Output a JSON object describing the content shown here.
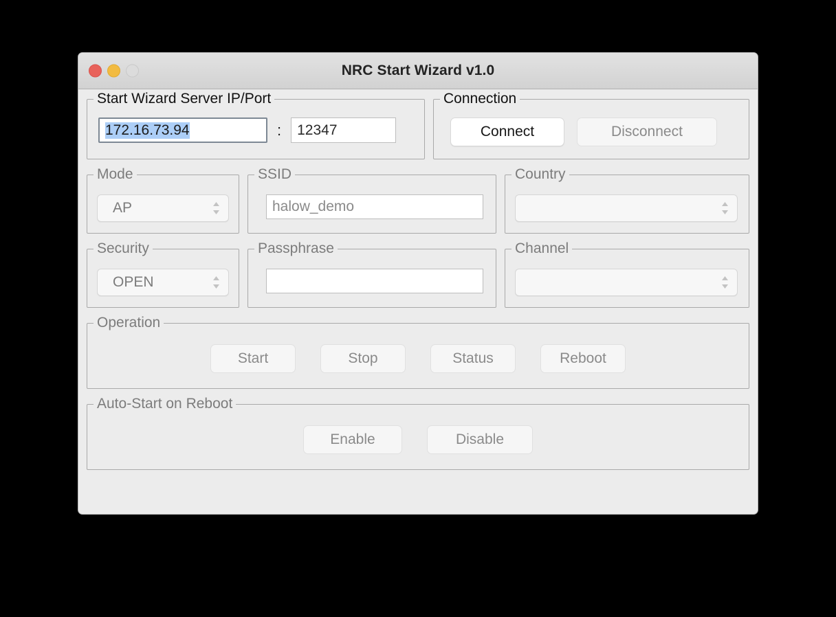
{
  "window": {
    "title": "NRC Start Wizard v1.0",
    "controls": {
      "close": "close-button",
      "minimize": "minimize-button",
      "zoom": "zoom-button"
    }
  },
  "server_group": {
    "legend": "Start Wizard Server IP/Port",
    "ip_value": "172.16.73.94",
    "separator": ":",
    "port_value": "12347"
  },
  "connection_group": {
    "legend": "Connection",
    "connect_label": "Connect",
    "disconnect_label": "Disconnect"
  },
  "mode_group": {
    "legend": "Mode",
    "value": "AP"
  },
  "ssid_group": {
    "legend": "SSID",
    "value": "halow_demo"
  },
  "country_group": {
    "legend": "Country",
    "value": ""
  },
  "security_group": {
    "legend": "Security",
    "value": "OPEN"
  },
  "passphrase_group": {
    "legend": "Passphrase",
    "value": ""
  },
  "channel_group": {
    "legend": "Channel",
    "value": ""
  },
  "operation_group": {
    "legend": "Operation",
    "start_label": "Start",
    "stop_label": "Stop",
    "status_label": "Status",
    "reboot_label": "Reboot"
  },
  "autostart_group": {
    "legend": "Auto-Start on Reboot",
    "enable_label": "Enable",
    "disable_label": "Disable"
  },
  "colors": {
    "window_bg": "#ececec",
    "titlebar": "#d8d8d8",
    "close": "#e8625b",
    "minimize": "#f2bb41",
    "zoom": "#dcdcdc",
    "selection": "#accef7",
    "disabled_text": "#8a8a8a",
    "enabled_text": "#161616",
    "group_border": "#a9a9a9"
  }
}
